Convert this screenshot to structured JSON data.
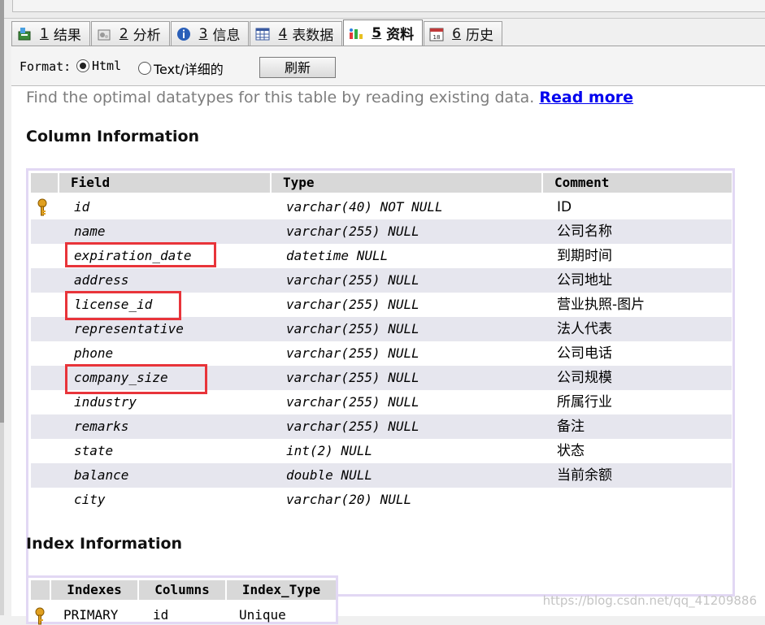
{
  "tabs": [
    {
      "num": "1",
      "label": "结果",
      "icon": "result-icon"
    },
    {
      "num": "2",
      "label": "分析",
      "icon": "analyze-icon"
    },
    {
      "num": "3",
      "label": "信息",
      "icon": "info-icon"
    },
    {
      "num": "4",
      "label": "表数据",
      "icon": "table-data-icon"
    },
    {
      "num": "5",
      "label": "资料",
      "icon": "profile-icon"
    },
    {
      "num": "6",
      "label": "历史",
      "icon": "history-icon"
    }
  ],
  "toolbar": {
    "format_label": "Format:",
    "html_label": "Html",
    "text_label": "Text/详细的",
    "refresh_label": "刷新",
    "selected": "Html"
  },
  "intro": {
    "text": "Find the optimal datatypes for this table by reading existing data. ",
    "link": "Read more"
  },
  "column_info": {
    "title": "Column Information",
    "headers": {
      "field": "Field",
      "type": "Type",
      "comment": "Comment"
    },
    "rows": [
      {
        "field": "id",
        "type": "varchar(40) NOT NULL",
        "comment": "ID"
      },
      {
        "field": "name",
        "type": "varchar(255) NULL",
        "comment": "公司名称"
      },
      {
        "field": "expiration_date",
        "type": "datetime NULL",
        "comment": "到期时间"
      },
      {
        "field": "address",
        "type": "varchar(255) NULL",
        "comment": "公司地址"
      },
      {
        "field": "license_id",
        "type": "varchar(255) NULL",
        "comment": "营业执照-图片"
      },
      {
        "field": "representative",
        "type": "varchar(255) NULL",
        "comment": "法人代表"
      },
      {
        "field": "phone",
        "type": "varchar(255) NULL",
        "comment": "公司电话"
      },
      {
        "field": "company_size",
        "type": "varchar(255) NULL",
        "comment": "公司规模"
      },
      {
        "field": "industry",
        "type": "varchar(255) NULL",
        "comment": "所属行业"
      },
      {
        "field": "remarks",
        "type": "varchar(255) NULL",
        "comment": "备注"
      },
      {
        "field": "state",
        "type": "int(2) NULL",
        "comment": "状态"
      },
      {
        "field": "balance",
        "type": "double NULL",
        "comment": "当前余额"
      },
      {
        "field": "city",
        "type": "varchar(20) NULL",
        "comment": ""
      }
    ]
  },
  "index_info": {
    "title": "Index Information",
    "headers": {
      "indexes": "Indexes",
      "columns": "Columns",
      "index_type": "Index_Type"
    },
    "rows": [
      {
        "indexes": "PRIMARY",
        "columns": "id",
        "index_type": "Unique"
      }
    ]
  },
  "watermark": "https://blog.csdn.net/qq_41209886",
  "colors": {
    "highlight": "#e8343a",
    "link": "#0000ee",
    "row_alt": "#e6e6ee",
    "table_border": "#e2d8f4"
  }
}
